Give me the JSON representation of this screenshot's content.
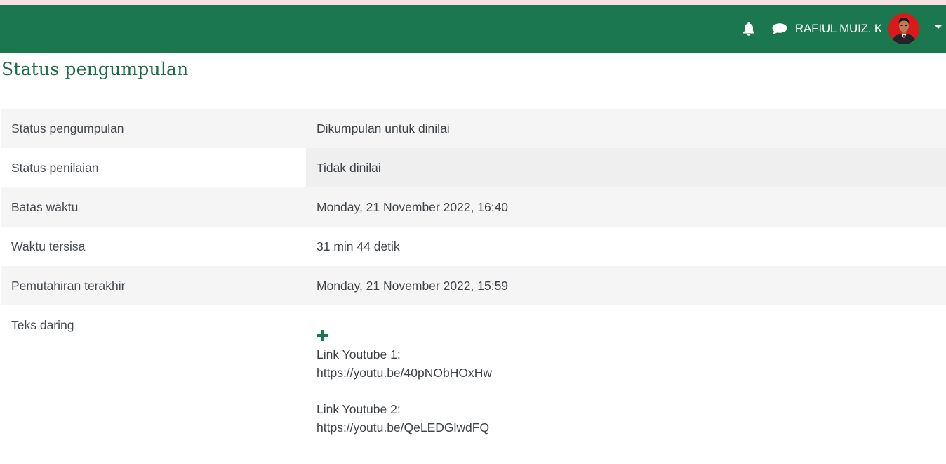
{
  "header": {
    "user_name": "RAFIUL MUIZ. K",
    "icons": [
      "bell-icon",
      "chat-icon",
      "user-avatar",
      "caret-down-icon"
    ],
    "brand_color": "#1b774d"
  },
  "page": {
    "title": "Status pengumpulan"
  },
  "table": {
    "rows": [
      {
        "label": "Status pengumpulan",
        "value": "Dikumpulan untuk dinilai"
      },
      {
        "label": "Status penilaian",
        "value": "Tidak dinilai"
      },
      {
        "label": "Batas waktu",
        "value": "Monday, 21 November 2022, 16:40"
      },
      {
        "label": "Waktu tersisa",
        "value": "31 min 44 detik"
      },
      {
        "label": "Pemutahiran terakhir",
        "value": "Monday, 21 November 2022, 15:59"
      },
      {
        "label": "Teks daring",
        "lines": [
          "Link Youtube 1:",
          "https://youtu.be/40pNObHOxHw",
          "Link Youtube 2:",
          "https://youtu.be/QeLEDGlwdFQ"
        ]
      }
    ]
  }
}
